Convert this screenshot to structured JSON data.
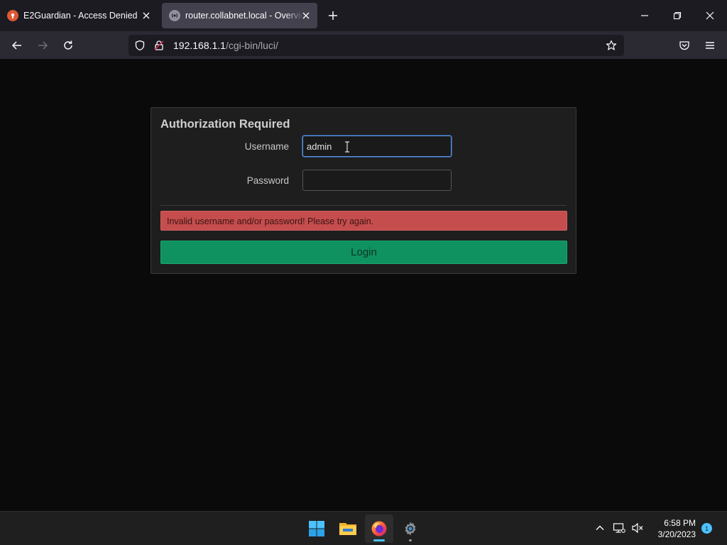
{
  "browser": {
    "tabs": [
      {
        "title": "E2Guardian - Access Denied",
        "active": false,
        "favicon": "duckduckgo-icon"
      },
      {
        "title": "router.collabnet.local - Overview",
        "active": true,
        "favicon": "broadcast-icon"
      }
    ],
    "url": {
      "host": "192.168.1.1",
      "path": "/cgi-bin/luci/"
    }
  },
  "page": {
    "title": "Authorization Required",
    "username_label": "Username",
    "username_value": "admin",
    "password_label": "Password",
    "password_value": "",
    "error_message": "Invalid username and/or password! Please try again.",
    "login_label": "Login"
  },
  "taskbar": {
    "apps": [
      "windows-start-icon",
      "file-explorer-icon",
      "firefox-icon",
      "settings-icon"
    ],
    "time": "6:58 PM",
    "date": "3/20/2023",
    "notification_count": "1"
  },
  "colors": {
    "error": "#c54d4d",
    "login": "#0f9160",
    "focus": "#5d8fd4",
    "accent": "#4cc2ff"
  }
}
